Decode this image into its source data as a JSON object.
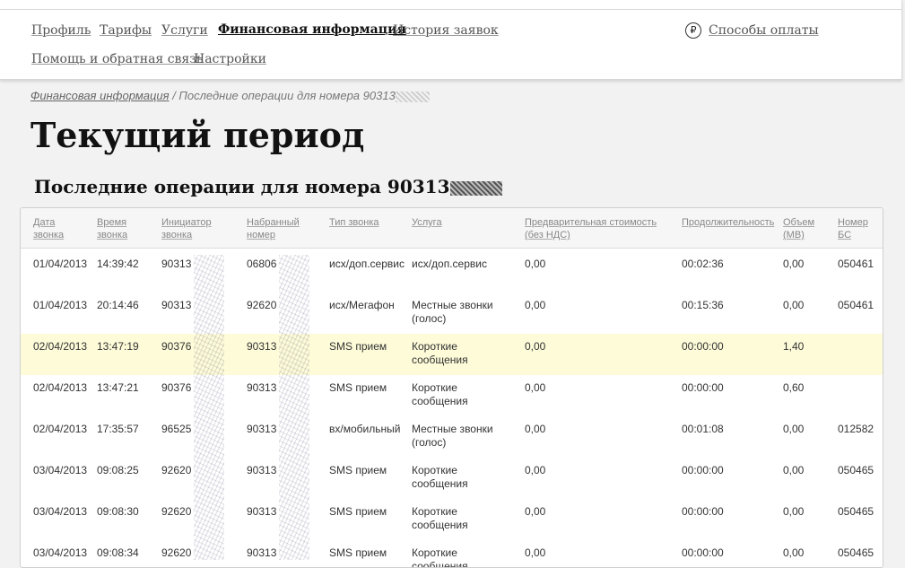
{
  "nav": {
    "items": [
      {
        "label": "Профиль",
        "active": false
      },
      {
        "label": "Тарифы",
        "active": false
      },
      {
        "label": "Услуги",
        "active": false
      },
      {
        "label": "Финансовая информация",
        "active": true
      },
      {
        "label": "История заявок",
        "active": false
      },
      {
        "label": "Помощь и обратная связь",
        "active": false
      },
      {
        "label": "Настройки",
        "active": false
      }
    ],
    "payment_icon": "ruble-icon",
    "payment_icon_glyph": "₽",
    "payment_label": "Способы оплаты"
  },
  "breadcrumb": {
    "link": "Финансовая информация",
    "separator": " / ",
    "current": "Последние операции для номера 90313"
  },
  "page_title": "Текущий период",
  "subtitle": "Последние операции для номера 90313",
  "table": {
    "columns": [
      "Дата\nзвонка",
      "Время\nзвонка",
      "Инициатор\nзвонка",
      "Набранный\nномер",
      "Тип звонка",
      "Услуга",
      "Предварительная стоимость\n(без НДС)",
      "Продолжительность",
      "Объем\n(МВ)",
      "Номер\nБС"
    ],
    "rows": [
      {
        "highlighted": false,
        "cells": [
          "01/04/2013",
          "14:39:42",
          "90313",
          "06806",
          "исх/доп.сервис",
          "исх/доп.сервис",
          "0,00",
          "00:02:36",
          "0,00",
          "050461"
        ]
      },
      {
        "highlighted": false,
        "cells": [
          "01/04/2013",
          "20:14:46",
          "90313",
          "92620",
          "исх/Мегафон",
          "Местные звонки\n(голос)",
          "0,00",
          "00:15:36",
          "0,00",
          "050461"
        ]
      },
      {
        "highlighted": true,
        "cells": [
          "02/04/2013",
          "13:47:19",
          "90376",
          "90313",
          "SMS прием",
          "Короткие\nсообщения",
          "0,00",
          "00:00:00",
          "1,40",
          ""
        ]
      },
      {
        "highlighted": false,
        "cells": [
          "02/04/2013",
          "13:47:21",
          "90376",
          "90313",
          "SMS прием",
          "Короткие\nсообщения",
          "0,00",
          "00:00:00",
          "0,60",
          ""
        ]
      },
      {
        "highlighted": false,
        "cells": [
          "02/04/2013",
          "17:35:57",
          "96525",
          "90313",
          "вх/мобильный",
          "Местные звонки\n(голос)",
          "0,00",
          "00:01:08",
          "0,00",
          "012582"
        ]
      },
      {
        "highlighted": false,
        "cells": [
          "03/04/2013",
          "09:08:25",
          "92620",
          "90313",
          "SMS прием",
          "Короткие\nсообщения",
          "0,00",
          "00:00:00",
          "0,00",
          "050465"
        ]
      },
      {
        "highlighted": false,
        "cells": [
          "03/04/2013",
          "09:08:30",
          "92620",
          "90313",
          "SMS прием",
          "Короткие\nсообщения",
          "0,00",
          "00:00:00",
          "0,00",
          "050465"
        ]
      },
      {
        "highlighted": false,
        "cells": [
          "03/04/2013",
          "09:08:34",
          "92620",
          "90313",
          "SMS прием",
          "Короткие\nсообщения",
          "0,00",
          "00:00:00",
          "0,00",
          "050465"
        ]
      }
    ]
  },
  "colors": {
    "highlight_row": "#fdfbd8",
    "active_nav": "#111111",
    "link": "#555555"
  }
}
